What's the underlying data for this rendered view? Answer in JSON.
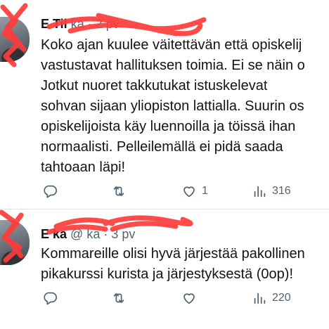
{
  "tweets": [
    {
      "author_name": "E   Til",
      "author_handle": "ka",
      "separator": "·",
      "time": "2 pv",
      "text_lines": [
        "Koko ajan kuulee väitettävän että opiskelij",
        "vastustavat hallituksen toimia. Ei se näin o",
        "Jotkut nuoret takkutukat istuskelevat",
        "sohvan sijaan yliopiston lattialla. Suurin os",
        "opiskelijoista käy luennoilla ja töissä ihan",
        "normaalisti. Pelleilemällä ei pidä saada",
        "tahtoaan läpi!"
      ],
      "actions": {
        "reply_count": "",
        "retweet_count": "",
        "like_count": "1",
        "views_count": "316"
      }
    },
    {
      "author_name": "E   ka",
      "author_handle": "@   ka",
      "separator": "·",
      "time": "3 pv",
      "text_lines": [
        "Kommareille olisi hyvä järjestää pakollinen",
        "pikakurssi kurista ja järjestyksestä (0op)!"
      ],
      "actions": {
        "reply_count": "",
        "retweet_count": "",
        "like_count": "",
        "views_count": "220"
      }
    }
  ],
  "icons": [
    "reply-icon",
    "retweet-icon",
    "like-icon",
    "views-icon"
  ],
  "colors": {
    "text": "#0f1419",
    "secondary": "#536471",
    "redaction": "#ff3b3b",
    "divider": "#dfe3e6"
  }
}
